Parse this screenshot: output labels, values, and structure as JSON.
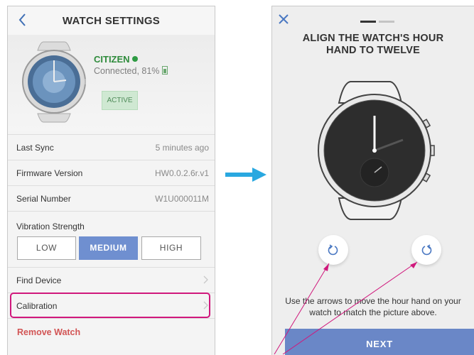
{
  "left": {
    "header": {
      "title": "WATCH SETTINGS"
    },
    "watch": {
      "brand": "CITIZEN",
      "status": "Connected, 81%",
      "badge": "ACTIVE"
    },
    "rows": [
      {
        "label": "Last Sync",
        "value": "5 minutes ago"
      },
      {
        "label": "Firmware Version",
        "value": "HW0.0.2.6r.v1"
      },
      {
        "label": "Serial Number",
        "value": "W1U000011M"
      }
    ],
    "vibration": {
      "label": "Vibration Strength",
      "options": [
        "LOW",
        "MEDIUM",
        "HIGH"
      ],
      "selected": "MEDIUM"
    },
    "find_device": "Find Device",
    "calibration": "Calibration",
    "remove": "Remove Watch"
  },
  "right": {
    "title_line1": "ALIGN THE WATCH'S HOUR",
    "title_line2": "HAND TO TWELVE",
    "instruction_line1": "Use the arrows to move the hour hand on your",
    "instruction_line2": "watch to match the picture above.",
    "next": "NEXT"
  },
  "colors": {
    "accent": "#6f8fd0",
    "highlight": "#d0187c",
    "arrow": "#29a8e0",
    "danger": "#d25555",
    "status_green": "#2e8b3b"
  }
}
